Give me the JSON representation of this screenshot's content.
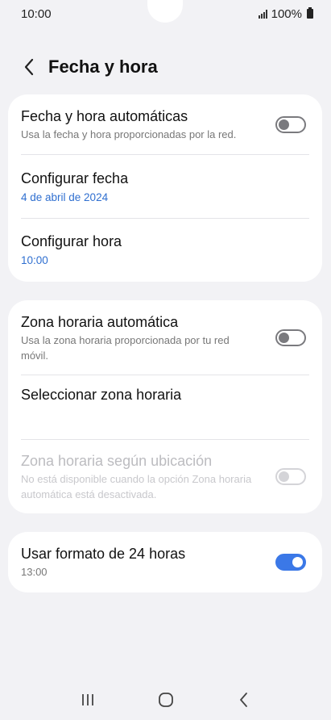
{
  "status_bar": {
    "time": "10:00",
    "battery": "100%"
  },
  "header": {
    "title": "Fecha y hora"
  },
  "sections": {
    "auto_datetime": {
      "title": "Fecha y hora automáticas",
      "subtitle": "Usa la fecha y hora proporcionadas por la red.",
      "enabled": false
    },
    "set_date": {
      "title": "Configurar fecha",
      "value": "4 de abril de 2024"
    },
    "set_time": {
      "title": "Configurar hora",
      "value": "10:00"
    },
    "auto_timezone": {
      "title": "Zona horaria automática",
      "subtitle": "Usa la zona horaria proporcionada por tu red móvil.",
      "enabled": false
    },
    "select_timezone": {
      "title": "Seleccionar zona horaria"
    },
    "location_timezone": {
      "title": "Zona horaria según ubicación",
      "subtitle": "No está disponible cuando la opción Zona horaria automática está desactivada.",
      "enabled": false
    },
    "format_24h": {
      "title": "Usar formato de 24 horas",
      "value": "13:00",
      "enabled": true
    }
  },
  "colors": {
    "accent": "#3b78e7",
    "link": "#2f6fd0",
    "background": "#f2f2f5"
  },
  "nav_icons": [
    "recent-apps-icon",
    "home-icon",
    "back-icon"
  ]
}
